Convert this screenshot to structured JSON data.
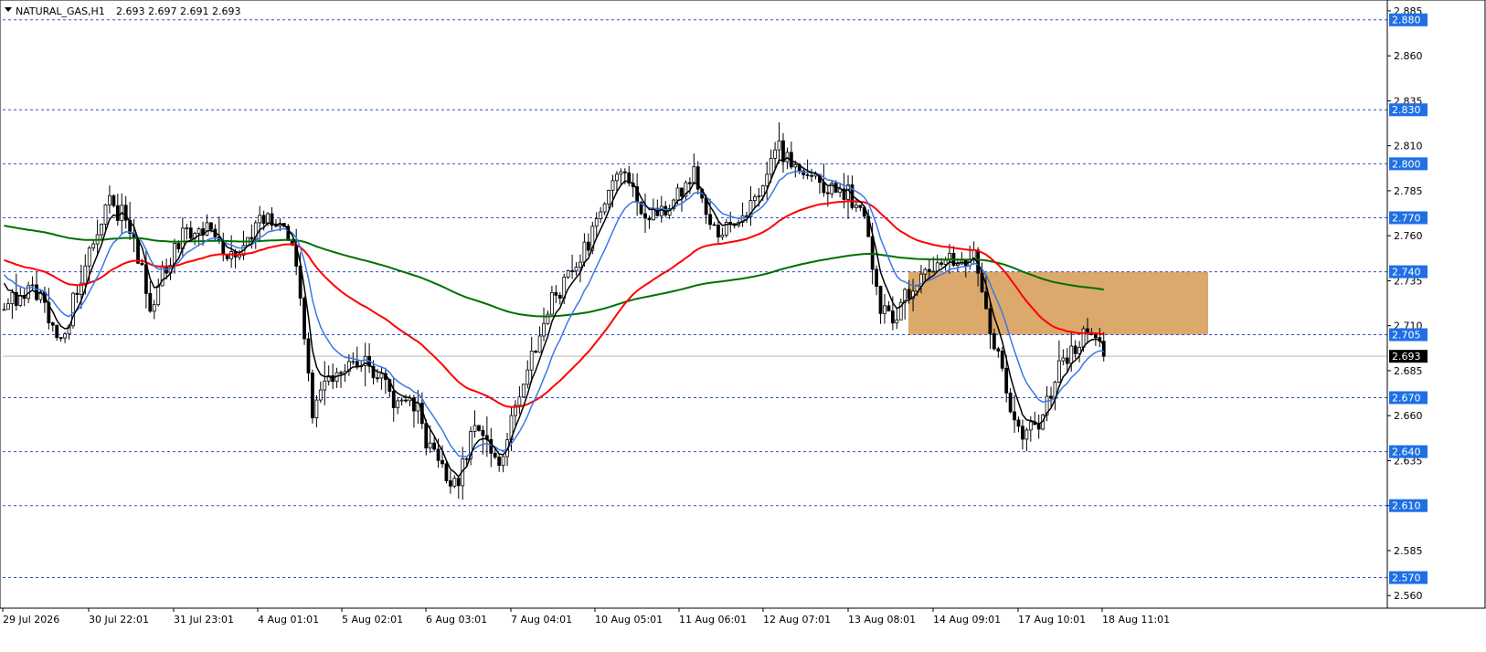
{
  "window": {
    "symbol_label": "NATURAL_GAS,H1",
    "ohlc_label": "2.693 2.697 2.691 2.693"
  },
  "colors": {
    "background": "#ffffff",
    "candle": "#000000",
    "level_line": "#2a4fd6",
    "level_badge": "#1f6fe5",
    "ema_fast": "#000000",
    "ema_mid": "#3a78e8",
    "ema_slow": "#ff0000",
    "ema_long": "#007000",
    "supply_zone": "#dba96b",
    "price_badge": "#000000"
  },
  "chart_data": {
    "type": "candlestick",
    "title": "NATURAL_GAS,H1",
    "ylim": [
      2.553,
      2.889
    ],
    "y_ticks": [
      2.56,
      2.585,
      2.61,
      2.635,
      2.66,
      2.685,
      2.71,
      2.735,
      2.76,
      2.785,
      2.81,
      2.835,
      2.86,
      2.885
    ],
    "x_ticks": [
      "29 Jul 2026",
      "30 Jul 22:01",
      "31 Jul 23:01",
      "4 Aug 01:01",
      "5 Aug 02:01",
      "6 Aug 03:01",
      "7 Aug 04:01",
      "10 Aug 05:01",
      "11 Aug 06:01",
      "12 Aug 07:01",
      "13 Aug 08:01",
      "14 Aug 09:01",
      "17 Aug 10:01",
      "18 Aug 11:01"
    ],
    "current_price": 2.693,
    "levels": [
      2.88,
      2.83,
      2.8,
      2.77,
      2.74,
      2.705,
      2.67,
      2.64,
      2.61,
      2.57
    ],
    "zone": {
      "from_label": "13 Aug 08:01",
      "to_label": "18 Aug 11:01",
      "low": 2.705,
      "high": 2.74
    },
    "price_path": [
      {
        "i": 0,
        "p": 2.725
      },
      {
        "i": 8,
        "p": 2.73
      },
      {
        "i": 14,
        "p": 2.7
      },
      {
        "i": 20,
        "p": 2.745
      },
      {
        "i": 26,
        "p": 2.78
      },
      {
        "i": 31,
        "p": 2.765
      },
      {
        "i": 36,
        "p": 2.72
      },
      {
        "i": 42,
        "p": 2.755
      },
      {
        "i": 48,
        "p": 2.765
      },
      {
        "i": 56,
        "p": 2.75
      },
      {
        "i": 64,
        "p": 2.77
      },
      {
        "i": 70,
        "p": 2.76
      },
      {
        "i": 73,
        "p": 2.73
      },
      {
        "i": 76,
        "p": 2.66
      },
      {
        "i": 80,
        "p": 2.68
      },
      {
        "i": 86,
        "p": 2.695
      },
      {
        "i": 92,
        "p": 2.68
      },
      {
        "i": 96,
        "p": 2.67
      },
      {
        "i": 100,
        "p": 2.675
      },
      {
        "i": 105,
        "p": 2.64
      },
      {
        "i": 111,
        "p": 2.62
      },
      {
        "i": 116,
        "p": 2.655
      },
      {
        "i": 122,
        "p": 2.63
      },
      {
        "i": 128,
        "p": 2.68
      },
      {
        "i": 134,
        "p": 2.72
      },
      {
        "i": 140,
        "p": 2.74
      },
      {
        "i": 146,
        "p": 2.765
      },
      {
        "i": 152,
        "p": 2.795
      },
      {
        "i": 158,
        "p": 2.77
      },
      {
        "i": 164,
        "p": 2.775
      },
      {
        "i": 170,
        "p": 2.795
      },
      {
        "i": 175,
        "p": 2.76
      },
      {
        "i": 180,
        "p": 2.765
      },
      {
        "i": 186,
        "p": 2.785
      },
      {
        "i": 191,
        "p": 2.81
      },
      {
        "i": 196,
        "p": 2.795
      },
      {
        "i": 202,
        "p": 2.785
      },
      {
        "i": 208,
        "p": 2.785
      },
      {
        "i": 212,
        "p": 2.77
      },
      {
        "i": 216,
        "p": 2.72
      },
      {
        "i": 220,
        "p": 2.715
      },
      {
        "i": 224,
        "p": 2.735
      },
      {
        "i": 230,
        "p": 2.745
      },
      {
        "i": 236,
        "p": 2.75
      },
      {
        "i": 240,
        "p": 2.745
      },
      {
        "i": 244,
        "p": 2.7
      },
      {
        "i": 247,
        "p": 2.675
      },
      {
        "i": 251,
        "p": 2.645
      },
      {
        "i": 256,
        "p": 2.66
      },
      {
        "i": 260,
        "p": 2.69
      },
      {
        "i": 264,
        "p": 2.7
      },
      {
        "i": 268,
        "p": 2.705
      },
      {
        "i": 271,
        "p": 2.695
      }
    ]
  }
}
